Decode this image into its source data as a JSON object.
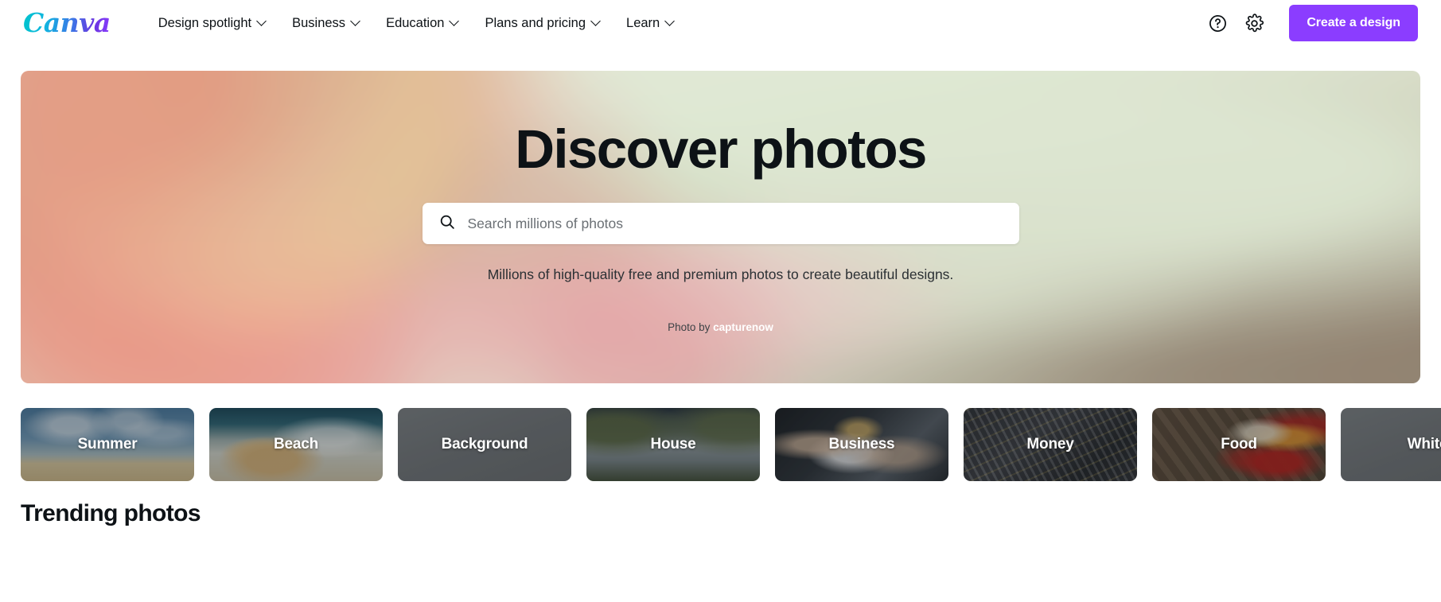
{
  "header": {
    "brand": "Canva",
    "nav": [
      {
        "label": "Design spotlight",
        "has_dropdown": true
      },
      {
        "label": "Business",
        "has_dropdown": true
      },
      {
        "label": "Education",
        "has_dropdown": true
      },
      {
        "label": "Plans and pricing",
        "has_dropdown": true
      },
      {
        "label": "Learn",
        "has_dropdown": true
      }
    ],
    "help_icon": "help-circle-icon",
    "settings_icon": "gear-icon",
    "cta_label": "Create a design",
    "cta_color": "#8B3DFF"
  },
  "hero": {
    "title": "Discover photos",
    "subtitle": "Millions of high-quality free and premium photos to create beautiful designs.",
    "credit_prefix": "Photo by",
    "credit_author": "capturenow",
    "search": {
      "placeholder": "Search millions of photos",
      "value": "",
      "icon": "search-icon"
    }
  },
  "categories": [
    {
      "label": "Summer",
      "art": "img-summer"
    },
    {
      "label": "Beach",
      "art": "img-beach"
    },
    {
      "label": "Background",
      "art": "img-background"
    },
    {
      "label": "House",
      "art": "img-house"
    },
    {
      "label": "Business",
      "art": "img-business"
    },
    {
      "label": "Money",
      "art": "img-money"
    },
    {
      "label": "Food",
      "art": "img-food"
    },
    {
      "label": "White",
      "art": "img-white"
    }
  ],
  "trending": {
    "title": "Trending photos"
  }
}
